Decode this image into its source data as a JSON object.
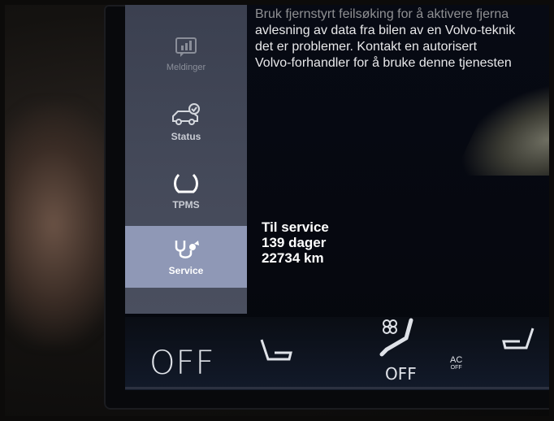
{
  "sidebar": {
    "items": [
      {
        "label": "Meldinger",
        "icon": "messages-icon"
      },
      {
        "label": "Status",
        "icon": "car-check-icon"
      },
      {
        "label": "TPMS",
        "icon": "tire-pressure-icon"
      },
      {
        "label": "Service",
        "icon": "stethoscope-icon"
      }
    ]
  },
  "message": {
    "line1": "Bruk fjernstyrt feilsøking for å aktivere fjerna",
    "line2": "avlesning av data fra bilen av en Volvo-teknik",
    "line3": "det er problemer. Kontakt en autorisert",
    "line4": "Volvo-forhandler for å bruke denne tjenesten"
  },
  "service": {
    "title": "Til service",
    "days": "139 dager",
    "distance": "22734 km"
  },
  "climate": {
    "left_temp": "OFF",
    "fan": "OFF",
    "ac_top": "AC",
    "ac_bottom": "OFF"
  },
  "colors": {
    "active_item": "#8f98b6",
    "sidebar": "#454a5a",
    "screen": "#070a14"
  }
}
